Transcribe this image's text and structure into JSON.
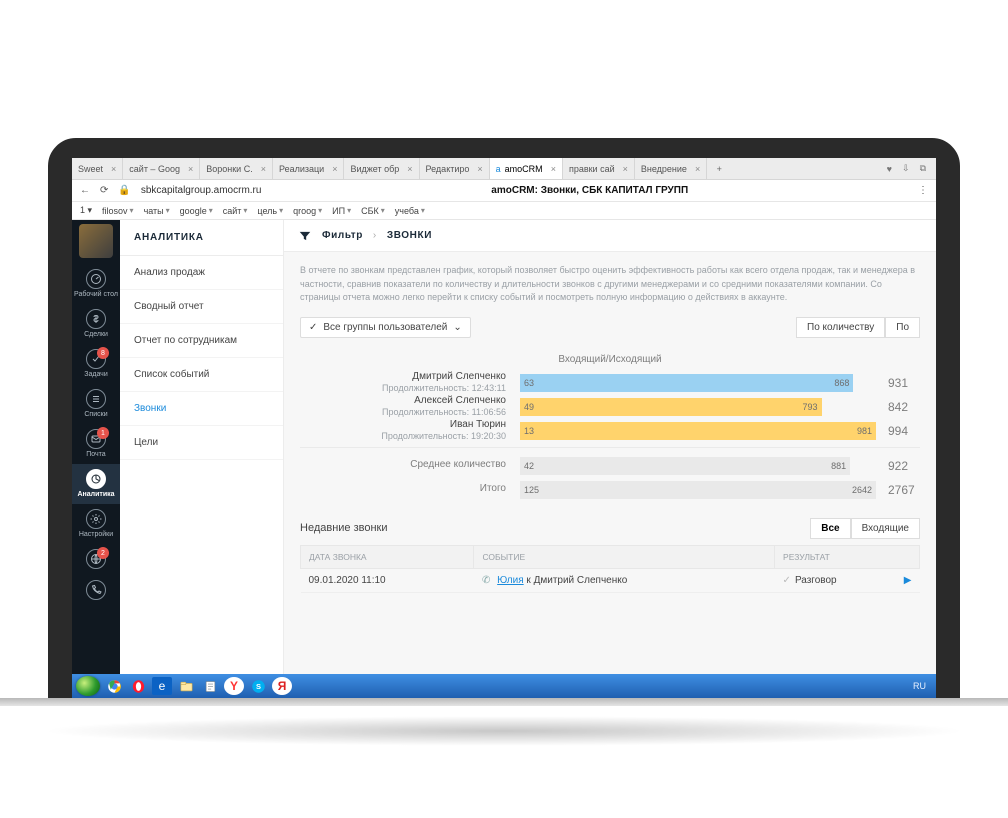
{
  "browser": {
    "tabs": [
      {
        "label": "Sweet",
        "close": "×"
      },
      {
        "label": "сайт – Goog",
        "close": "×"
      },
      {
        "label": "Воронки С.",
        "close": "×"
      },
      {
        "label": "Реализаци",
        "close": "×"
      },
      {
        "label": "Виджет обр",
        "close": "×"
      },
      {
        "label": "Редактиро",
        "close": "×"
      },
      {
        "label": "amoCRM",
        "close": "×",
        "active": true
      },
      {
        "label": "правки сай",
        "close": "×"
      },
      {
        "label": "Внедрение",
        "close": "×"
      }
    ],
    "add_tab": "+",
    "window": {
      "volume": "♥",
      "downloads": "⇩",
      "book": "⧉"
    },
    "back": "←",
    "reload": "⟳",
    "lock": "🔒",
    "url": "sbkcapitalgroup.amocrm.ru",
    "page_title": "amoCRM: Звонки, СБК КАПИТАЛ ГРУПП",
    "zoom_icon": "⋮"
  },
  "bookmarks": {
    "count_label": "1 ▾",
    "items": [
      "filosov",
      "чаты",
      "google",
      "сайт",
      "цель",
      "qroog",
      "ИП",
      "СБК",
      "учеба"
    ]
  },
  "rail": {
    "items": [
      {
        "key": "desk",
        "label": "Рабочий стол"
      },
      {
        "key": "deals",
        "label": "Сделки"
      },
      {
        "key": "tasks",
        "label": "Задачи",
        "badge": "8"
      },
      {
        "key": "lists",
        "label": "Списки"
      },
      {
        "key": "mail",
        "label": "Почта",
        "badge": "1"
      },
      {
        "key": "analytics",
        "label": "Аналитика",
        "active": true
      },
      {
        "key": "settings",
        "label": "Настройки"
      },
      {
        "key": "more1",
        "label": "",
        "badge": "2"
      },
      {
        "key": "more2",
        "label": ""
      }
    ]
  },
  "subnav": {
    "title": "АНАЛИТИКА",
    "items": [
      {
        "label": "Анализ продаж"
      },
      {
        "label": "Сводный отчет"
      },
      {
        "label": "Отчет по сотрудникам"
      },
      {
        "label": "Список событий"
      },
      {
        "label": "Звонки",
        "active": true
      },
      {
        "label": "Цели"
      }
    ]
  },
  "filter": {
    "label": "Фильтр",
    "chev": "›",
    "section": "ЗВОНКИ"
  },
  "description": "В отчете по звонкам представлен график, который позволяет быстро оценить эффективность работы как всего отдела продаж, так и менеджера в частности, сравнив показатели по количеству и длительности звонков с другими менеджерами и со средними показателями компании. Со страницы отчета можно легко перейти к списку событий и посмотреть полную информацию о действиях в аккаунте.",
  "groups": {
    "check": "✓",
    "label": "Все группы пользователей"
  },
  "toggle": {
    "by_count": "По количеству",
    "by_other": "По"
  },
  "chart_data": {
    "type": "bar",
    "title": "Входящий/Исходящий",
    "series_meta": [
      "incoming",
      "outgoing"
    ],
    "max_total": 994,
    "rows": [
      {
        "name": "Дмитрий Слепченко",
        "sub": "Продолжительность: 12:43:11",
        "incoming": 63,
        "outgoing": 868,
        "total": 931,
        "style": "blue"
      },
      {
        "name": "Алексей Слепченко",
        "sub": "Продолжительность: 11:06:56",
        "incoming": 49,
        "outgoing": 793,
        "total": 842,
        "style": "yellow"
      },
      {
        "name": "Иван Тюрин",
        "sub": "Продолжительность: 19:20:30",
        "incoming": 13,
        "outgoing": 981,
        "total": 994,
        "style": "yellow"
      }
    ],
    "summary": [
      {
        "name": "Среднее количество",
        "incoming": 42,
        "outgoing": 881,
        "total": 922
      },
      {
        "name": "Итого",
        "incoming": 125,
        "outgoing": 2642,
        "total": 2767
      }
    ]
  },
  "recent": {
    "title": "Недавние звонки",
    "tabs": {
      "all": "Все",
      "incoming": "Входящие"
    },
    "columns": {
      "date": "ДАТА ЗВОНКА",
      "event": "СОБЫТИЕ",
      "result": "РЕЗУЛЬТАТ"
    },
    "rows": [
      {
        "date": "09.01.2020 11:10",
        "from": "Юлия",
        "to_prefix": " к ",
        "to": "Дмитрий Слепченко",
        "result": "Разговор"
      }
    ]
  },
  "taskbar": {
    "lang": "RU"
  }
}
